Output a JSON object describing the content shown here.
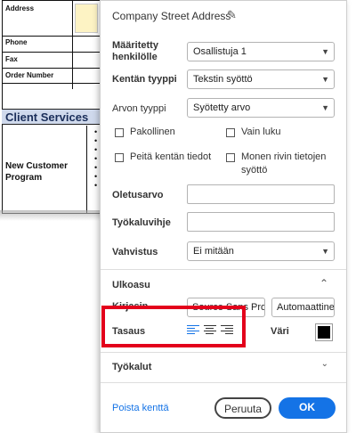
{
  "document": {
    "rows": [
      "Address",
      "Phone",
      "Fax",
      "Order Number"
    ],
    "section_header": "Client Services",
    "row_label": "New Customer Program",
    "bullets": [
      "•",
      "•",
      "•",
      "•",
      "•",
      "•",
      "•"
    ]
  },
  "dialog": {
    "title": "Company Street Address",
    "assigned_label": "Määritetty henkilölle",
    "assigned_value": "Osallistuja 1",
    "field_type_label": "Kentän tyyppi",
    "field_type_value": "Tekstin syöttö",
    "value_type_label": "Arvon tyyppi",
    "value_type_value": "Syötetty arvo",
    "checkboxes": {
      "required": "Pakollinen",
      "read_only": "Vain luku",
      "hide_field": "Peitä kentän tiedot",
      "multiline": "Monen rivin tietojen syöttö"
    },
    "default_label": "Oletusarvo",
    "tooltip_label": "Työkaluvihje",
    "validation_label": "Vahvistus",
    "validation_value": "Ei mitään",
    "appearance_section": "Ulkoasu",
    "font_label": "Kirjasin",
    "font_value": "Source Sans Pro",
    "font_size_value": "Automaattinen",
    "alignment_label": "Tasaus",
    "color_label": "Väri",
    "text_color": "#000000",
    "tools_section": "Työkalut",
    "delete_link": "Poista kenttä",
    "cancel_button": "Peruuta",
    "ok_button": "OK"
  },
  "colors": {
    "accent": "#1473e6",
    "highlight_border": "#e3001b"
  },
  "icons": {
    "edit": "pencil-icon",
    "dropdown": "chevron-down-icon",
    "collapse": "chevron-up-icon",
    "expand": "chevron-down-icon"
  }
}
